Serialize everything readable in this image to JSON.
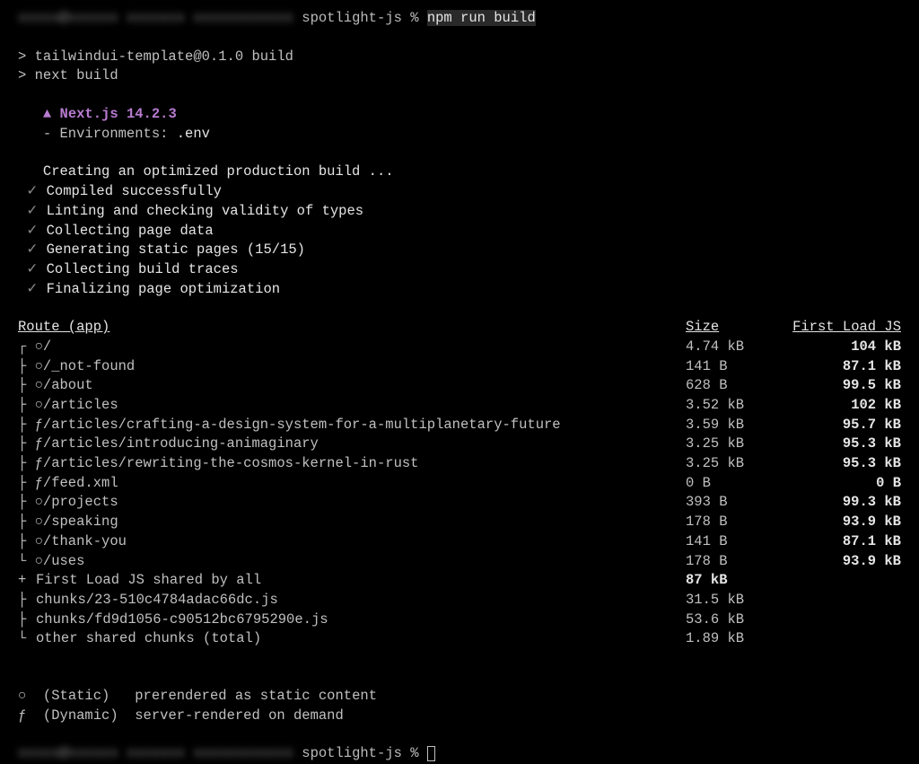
{
  "prompt1": {
    "blurred_prefix": "xxxxx@xxxxxx xxxxxxx xxxxxxxxxxxx",
    "path": "spotlight-js",
    "symbol": "%",
    "command": "npm run build"
  },
  "npm_output": {
    "line1": "> tailwindui-template@0.1.0 build",
    "line2": "> next build"
  },
  "nextjs": {
    "triangle": "▲",
    "name": "Next.js 14.2.3",
    "env_label": "- Environments: ",
    "env_value": ".env"
  },
  "build_steps": {
    "creating": "   Creating an optimized production build ...",
    "steps": [
      "Compiled successfully",
      "Linting and checking validity of types",
      "Collecting page data",
      "Generating static pages (15/15)",
      "Collecting build traces",
      "Finalizing page optimization"
    ],
    "check": "✓"
  },
  "table_header": {
    "route": "Route (app)",
    "size": "Size",
    "first": "First Load JS"
  },
  "routes": [
    {
      "tree": "┌ ○ ",
      "path": "/",
      "size": "4.74 kB",
      "first": "104 kB",
      "bold": true
    },
    {
      "tree": "├ ○ ",
      "path": "/_not-found",
      "size": "141 B",
      "first": "87.1 kB",
      "bold": true
    },
    {
      "tree": "├ ○ ",
      "path": "/about",
      "size": "628 B",
      "first": "99.5 kB",
      "bold": true
    },
    {
      "tree": "├ ○ ",
      "path": "/articles",
      "size": "3.52 kB",
      "first": "102 kB",
      "bold": true
    },
    {
      "tree": "├ ƒ ",
      "path": "/articles/crafting-a-design-system-for-a-multiplanetary-future",
      "size": "3.59 kB",
      "first": "95.7 kB",
      "bold": true
    },
    {
      "tree": "├ ƒ ",
      "path": "/articles/introducing-animaginary",
      "size": "3.25 kB",
      "first": "95.3 kB",
      "bold": true
    },
    {
      "tree": "├ ƒ ",
      "path": "/articles/rewriting-the-cosmos-kernel-in-rust",
      "size": "3.25 kB",
      "first": "95.3 kB",
      "bold": true
    },
    {
      "tree": "├ ƒ ",
      "path": "/feed.xml",
      "size": "0 B",
      "first": "0 B",
      "bold": true
    },
    {
      "tree": "├ ○ ",
      "path": "/projects",
      "size": "393 B",
      "first": "99.3 kB",
      "bold": true
    },
    {
      "tree": "├ ○ ",
      "path": "/speaking",
      "size": "178 B",
      "first": "93.9 kB",
      "bold": true
    },
    {
      "tree": "├ ○ ",
      "path": "/thank-you",
      "size": "141 B",
      "first": "87.1 kB",
      "bold": true
    },
    {
      "tree": "└ ○ ",
      "path": "/uses",
      "size": "178 B",
      "first": "93.9 kB",
      "bold": true
    }
  ],
  "shared": {
    "header_tree": "+ ",
    "header_text": "First Load JS shared by all",
    "header_size": "87 kB",
    "chunks": [
      {
        "tree": "  ├ ",
        "path": "chunks/23-510c4784adac66dc.js",
        "size": "31.5 kB"
      },
      {
        "tree": "  ├ ",
        "path": "chunks/fd9d1056-c90512bc6795290e.js",
        "size": "53.6 kB"
      },
      {
        "tree": "  └ ",
        "path": "other shared chunks (total)",
        "size": "1.89 kB"
      }
    ]
  },
  "legend": {
    "static_symbol": "○",
    "static_label": "(Static)",
    "static_desc": "prerendered as static content",
    "dynamic_symbol": "ƒ",
    "dynamic_label": "(Dynamic)",
    "dynamic_desc": "server-rendered on demand"
  },
  "prompt2": {
    "blurred_prefix": "xxxxx@xxxxxx xxxxxxx xxxxxxxxxxxx",
    "path": "spotlight-js",
    "symbol": "%"
  }
}
